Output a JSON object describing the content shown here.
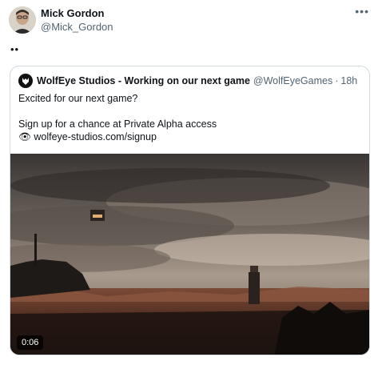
{
  "author": {
    "name": "Mick Gordon",
    "handle": "@Mick_Gordon",
    "more_icon": "more-horizontal-icon"
  },
  "tweet": {
    "text": "••"
  },
  "quoted": {
    "name": "WolfEye Studios - Working on our next game",
    "handle": "@WolfEyeGames",
    "separator": "·",
    "time": "18h",
    "line1": "Excited for our next game?",
    "line2": "Sign up for a chance at Private Alpha access",
    "link_emoji": "👁",
    "link": "wolfeye-studios.com/signup",
    "video_duration": "0:06"
  },
  "colors": {
    "text": "#0f1419",
    "secondary": "#536471",
    "border": "#cfd9de"
  }
}
